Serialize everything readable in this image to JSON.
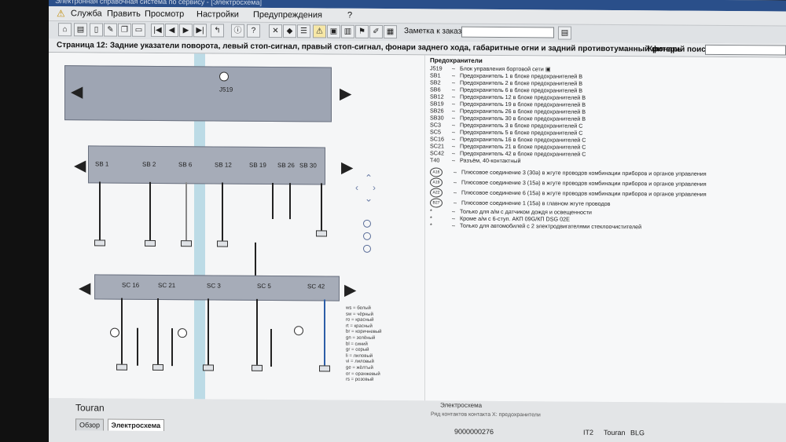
{
  "window": {
    "title": "Электронная справочная система по сервису - [Электросхема]"
  },
  "menu": {
    "items": [
      {
        "label": "Служба"
      },
      {
        "label": "Править"
      },
      {
        "label": "Просмотр"
      },
      {
        "label": "Настройки"
      },
      {
        "label": "Предупреждения"
      },
      {
        "label": "?"
      }
    ]
  },
  "toolbar": {
    "order_note_label": "Заметка к заказу:",
    "order_note_value": ""
  },
  "page": {
    "title": "Страница 12: Задние указатели поворота, левый стоп-сигнал, правый стоп-сигнал, фонари заднего хода, габаритные огни и задний противотуманный фонарь",
    "search_label": "Критерий поиска:",
    "search_value": ""
  },
  "diagram": {
    "control_unit_label": "J519",
    "sb_fuses": [
      "SB 1",
      "SB 2",
      "SB 6",
      "SB 12",
      "SB 19",
      "SB 26",
      "SB 30"
    ],
    "sc_fuses": [
      "SC 16",
      "SC 21",
      "SC 3",
      "SC 5",
      "SC 42"
    ],
    "color_codes": [
      {
        "code": "ws",
        "name": "белый"
      },
      {
        "code": "sw",
        "name": "чёрный"
      },
      {
        "code": "ro",
        "name": "красный"
      },
      {
        "code": "rt",
        "name": "красный"
      },
      {
        "code": "br",
        "name": "коричневый"
      },
      {
        "code": "gn",
        "name": "зелёный"
      },
      {
        "code": "bl",
        "name": "синий"
      },
      {
        "code": "gr",
        "name": "серый"
      },
      {
        "code": "li",
        "name": "лиловый"
      },
      {
        "code": "vi",
        "name": "лиловый"
      },
      {
        "code": "ge",
        "name": "жёлтый"
      },
      {
        "code": "or",
        "name": "оранжевый"
      },
      {
        "code": "rs",
        "name": "розовый"
      }
    ]
  },
  "legend": {
    "title": "Предохранители",
    "items": [
      {
        "code": "J519",
        "text": "Блок управления бортовой сети"
      },
      {
        "code": "SB1",
        "text": "Предохранитель 1 в блоке предохранителей B"
      },
      {
        "code": "SB2",
        "text": "Предохранитель 2 в блоке предохранителей B"
      },
      {
        "code": "SB6",
        "text": "Предохранитель 6 в блоке предохранителей B"
      },
      {
        "code": "SB12",
        "text": "Предохранитель 12 в блоке предохранителей B"
      },
      {
        "code": "SB19",
        "text": "Предохранитель 19 в блоке предохранителей B"
      },
      {
        "code": "SB26",
        "text": "Предохранитель 26 в блоке предохранителей B"
      },
      {
        "code": "SB30",
        "text": "Предохранитель 30 в блоке предохранителей B"
      },
      {
        "code": "SC3",
        "text": "Предохранитель 3 в блоке предохранителей C"
      },
      {
        "code": "SC5",
        "text": "Предохранитель 5 в блоке предохранителей C"
      },
      {
        "code": "SC16",
        "text": "Предохранитель 16 в блоке предохранителей C"
      },
      {
        "code": "SC21",
        "text": "Предохранитель 21 в блоке предохранителей C"
      },
      {
        "code": "SC42",
        "text": "Предохранитель 42 в блоке предохранителей C"
      },
      {
        "code": "T40",
        "text": "Разъём, 40-контактный"
      }
    ],
    "connectors": [
      {
        "code": "A16",
        "text": "Плюсовое соединение 3 (30a) в жгуте проводов комбинации приборов и органов управления"
      },
      {
        "code": "A19",
        "text": "Плюсовое соединение 3 (15a) в жгуте проводов комбинации приборов и органов управления"
      },
      {
        "code": "A22",
        "text": "Плюсовое соединение 6 (15a) в жгуте проводов комбинации приборов и органов управления"
      },
      {
        "code": "B27",
        "text": "Плюсовое соединение 1 (15a) в главном жгуте проводов"
      }
    ],
    "notes": [
      {
        "mark": "*",
        "text": "Только для а/м с датчиком дождя и освещенности"
      },
      {
        "mark": "*",
        "text": "Кроме а/м с 6-ступ. АКП 09G/КП DSG 02E"
      },
      {
        "mark": "*",
        "text": "Только для автомобилей с 2 электродвигателями стеклоочистителей"
      }
    ]
  },
  "bottom": {
    "model": "Touran",
    "scheme_caption": "Электросхема",
    "scheme_caption2": "Ряд контактов контакта X: предохранители",
    "tabs": [
      {
        "label": "Обзор"
      },
      {
        "label": "Электросхема"
      }
    ],
    "doc_number": "9000000276",
    "status_1": "IT2",
    "status_2": "Touran",
    "status_3": "BLG"
  }
}
